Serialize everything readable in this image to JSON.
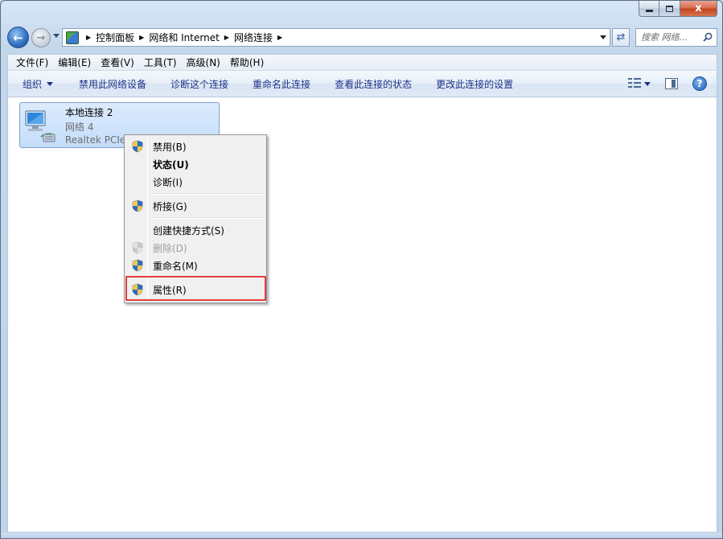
{
  "window": {
    "caption": {
      "minimize": "",
      "maximize": "",
      "close": "x"
    }
  },
  "address": {
    "breadcrumbs": [
      "控制面板",
      "网络和 Internet",
      "网络连接"
    ],
    "search_placeholder": "搜索 网络..."
  },
  "menubar": {
    "items": [
      "文件(F)",
      "编辑(E)",
      "查看(V)",
      "工具(T)",
      "高级(N)",
      "帮助(H)"
    ]
  },
  "cmdbar": {
    "organize": "组织",
    "commands": [
      "禁用此网络设备",
      "诊断这个连接",
      "重命名此连接",
      "查看此连接的状态",
      "更改此连接的设置"
    ]
  },
  "connection": {
    "name": "本地连接 2",
    "network": "网络  4",
    "adapter": "Realtek PCIe"
  },
  "context_menu": {
    "items": [
      {
        "label": "禁用(B)",
        "shield": true,
        "bold": false,
        "disabled": false
      },
      {
        "label": "状态(U)",
        "shield": false,
        "bold": true,
        "disabled": false
      },
      {
        "label": "诊断(I)",
        "shield": false,
        "bold": false,
        "disabled": false
      },
      {
        "label": "桥接(G)",
        "shield": true,
        "bold": false,
        "disabled": false
      },
      {
        "label": "创建快捷方式(S)",
        "shield": false,
        "bold": false,
        "disabled": false
      },
      {
        "label": "删除(D)",
        "shield": true,
        "bold": false,
        "disabled": true
      },
      {
        "label": "重命名(M)",
        "shield": true,
        "bold": false,
        "disabled": false
      },
      {
        "label": "属性(R)",
        "shield": true,
        "bold": false,
        "disabled": false
      }
    ]
  },
  "colors": {
    "highlight_border": "#e23b3b",
    "command_text": "#1e3287",
    "selection_fill": "#c4ddfb"
  },
  "icons": {
    "back": "back-arrow-icon",
    "forward": "forward-arrow-icon",
    "refresh": "refresh-icon",
    "search": "search-icon",
    "shield": "uac-shield-icon",
    "help": "help-icon"
  }
}
